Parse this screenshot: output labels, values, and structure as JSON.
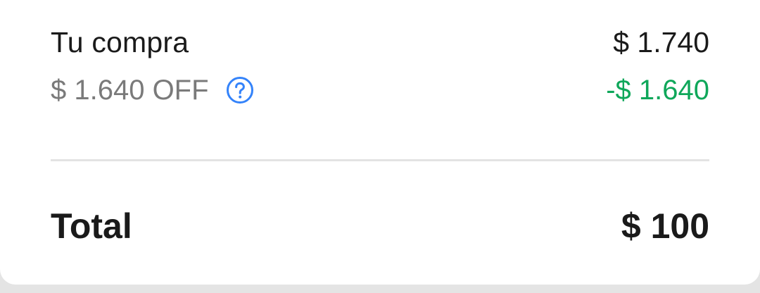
{
  "summary": {
    "purchase_label": "Tu compra",
    "purchase_value": "$ 1.740",
    "discount_label": "$ 1.640 OFF",
    "discount_value": "-$ 1.640",
    "help_icon": "question-circle-icon",
    "total_label": "Total",
    "total_value": "$ 100"
  },
  "colors": {
    "text_primary": "#1a1a1a",
    "text_secondary": "#7a7a7a",
    "discount_green": "#0fa75a",
    "help_blue": "#3483fa",
    "divider": "#e3e3e3"
  }
}
